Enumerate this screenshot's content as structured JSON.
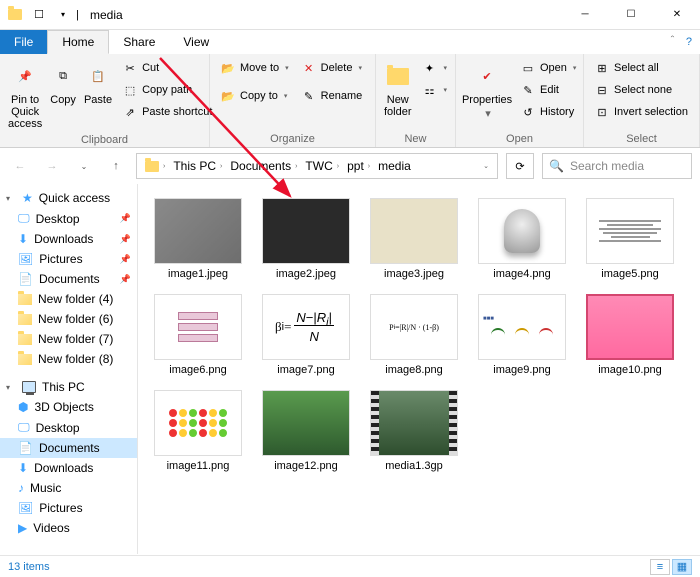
{
  "title": "media",
  "tabs": {
    "file": "File",
    "home": "Home",
    "share": "Share",
    "view": "View"
  },
  "ribbon": {
    "clipboard": {
      "label": "Clipboard",
      "pin": "Pin to Quick\naccess",
      "copy": "Copy",
      "paste": "Paste",
      "cut": "Cut",
      "copypath": "Copy path",
      "pasteshort": "Paste shortcut"
    },
    "organize": {
      "label": "Organize",
      "moveto": "Move to",
      "copyto": "Copy to",
      "delete": "Delete",
      "rename": "Rename"
    },
    "new": {
      "label": "New",
      "newfolder": "New\nfolder"
    },
    "open": {
      "label": "Open",
      "properties": "Properties",
      "open": "Open",
      "edit": "Edit",
      "history": "History"
    },
    "select": {
      "label": "Select",
      "all": "Select all",
      "none": "Select none",
      "invert": "Invert selection"
    }
  },
  "breadcrumb": [
    "This PC",
    "Documents",
    "TWC",
    "ppt",
    "media"
  ],
  "search_placeholder": "Search media",
  "sidebar": {
    "quick": "Quick access",
    "quick_items": [
      {
        "label": "Desktop",
        "pin": true,
        "key": "desktop"
      },
      {
        "label": "Downloads",
        "pin": true,
        "key": "downloads"
      },
      {
        "label": "Pictures",
        "pin": true,
        "key": "pictures"
      },
      {
        "label": "Documents",
        "pin": true,
        "key": "documents"
      },
      {
        "label": "New folder (4)",
        "pin": false,
        "key": "nf4"
      },
      {
        "label": "New folder (6)",
        "pin": false,
        "key": "nf6"
      },
      {
        "label": "New folder (7)",
        "pin": false,
        "key": "nf7"
      },
      {
        "label": "New folder (8)",
        "pin": false,
        "key": "nf8"
      }
    ],
    "thispc": "This PC",
    "pc_items": [
      {
        "label": "3D Objects",
        "key": "3d"
      },
      {
        "label": "Desktop",
        "key": "desktop2"
      },
      {
        "label": "Documents",
        "key": "documents2",
        "selected": true
      },
      {
        "label": "Downloads",
        "key": "downloads2"
      },
      {
        "label": "Music",
        "key": "music"
      },
      {
        "label": "Pictures",
        "key": "pictures2"
      },
      {
        "label": "Videos",
        "key": "videos"
      }
    ]
  },
  "files": [
    {
      "name": "image1.jpeg",
      "thumb": "gray"
    },
    {
      "name": "image2.jpeg",
      "thumb": "dark"
    },
    {
      "name": "image3.jpeg",
      "thumb": "paper"
    },
    {
      "name": "image4.png",
      "thumb": "stamp"
    },
    {
      "name": "image5.png",
      "thumb": "doc"
    },
    {
      "name": "image6.png",
      "thumb": "boxes"
    },
    {
      "name": "image7.png",
      "thumb": "formula"
    },
    {
      "name": "image8.png",
      "thumb": "formula2"
    },
    {
      "name": "image9.png",
      "thumb": "gauge"
    },
    {
      "name": "image10.png",
      "thumb": "pink"
    },
    {
      "name": "image11.png",
      "thumb": "grid"
    },
    {
      "name": "image12.png",
      "thumb": "green"
    },
    {
      "name": "media1.3gp",
      "thumb": "film"
    }
  ],
  "status": {
    "count": "13 items"
  }
}
